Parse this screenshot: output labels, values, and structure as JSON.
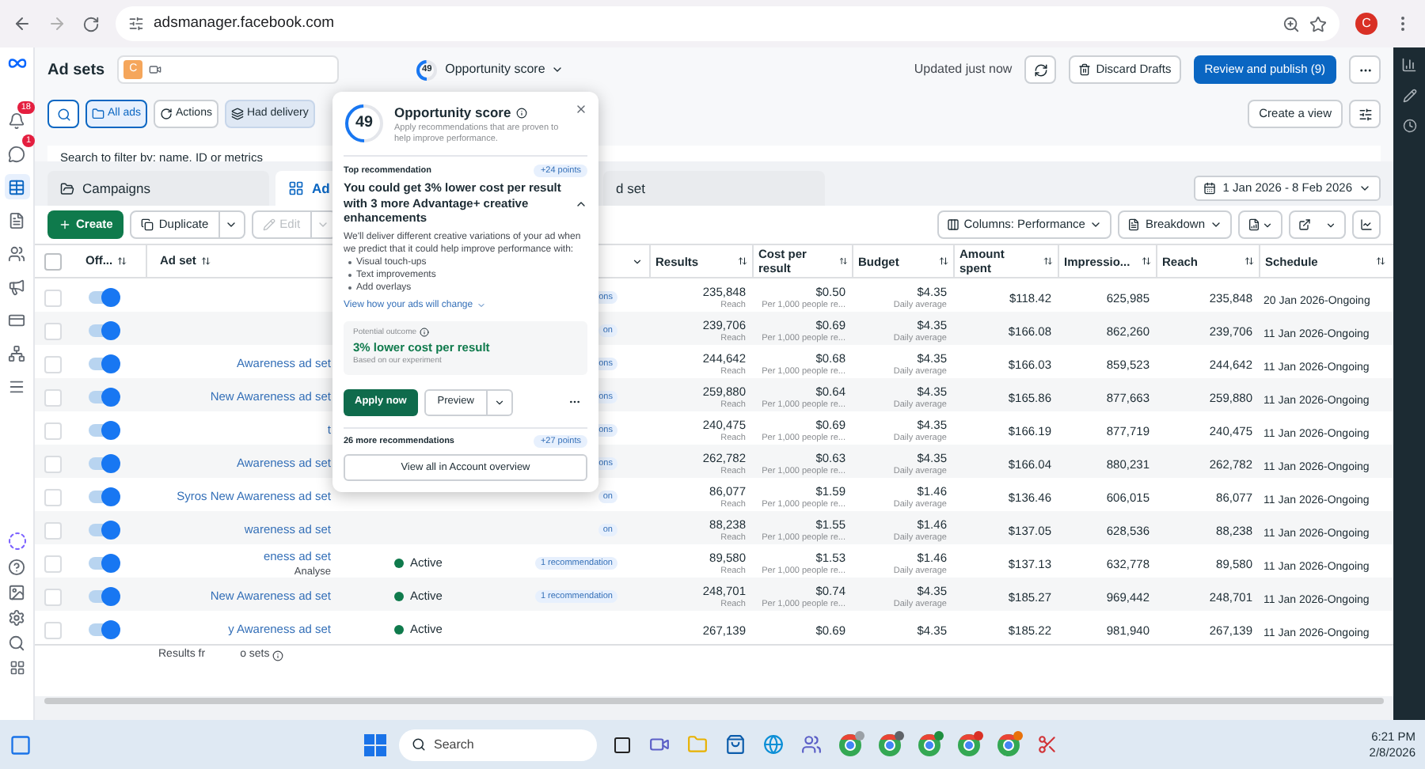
{
  "browser": {
    "url": "adsmanager.facebook.com",
    "avatar": "C"
  },
  "header": {
    "title": "Ad sets",
    "account_badge": "C",
    "score": {
      "value": "49",
      "label": "Opportunity score",
      "level": 0.49
    },
    "updated": "Updated just now",
    "discard": "Discard Drafts",
    "publish": "Review and publish (9)"
  },
  "nav_items": [
    {
      "selected": false,
      "badge": "18"
    },
    {
      "selected": false,
      "badge": "1"
    },
    {
      "selected": true
    },
    {
      "selected": false
    },
    {
      "selected": false
    },
    {
      "selected": false
    },
    {
      "selected": false
    },
    {
      "selected": false
    },
    {
      "selected": false
    }
  ],
  "filters": [
    {
      "kind": "view",
      "label": "All ads"
    },
    {
      "kind": "action",
      "label": "Actions"
    },
    {
      "kind": "filter",
      "label": "Had delivery"
    }
  ],
  "create_view": "Create a view",
  "search": {
    "placeholder": "Search to filter by: name, ID or metrics"
  },
  "tabs": [
    {
      "label": "Campaigns",
      "selected": false
    },
    {
      "label": "Ad",
      "selected": true
    },
    {
      "label": "d set",
      "selected": false
    }
  ],
  "date_range": "1 Jan 2026 - 8 Feb 2026",
  "toolbar": {
    "buttons": [
      {
        "label": "Create",
        "kind": "primary",
        "disabled": false
      },
      {
        "label": "Duplicate",
        "kind": "split",
        "disabled": false
      },
      {
        "label": "Edit",
        "kind": "split",
        "disabled": true
      }
    ],
    "columns": "Columns: Performance",
    "breakdown": "Breakdown"
  },
  "table": {
    "select_all_checked": false,
    "columns": [
      "Off...",
      "Ad set",
      "Results",
      "Cost per result",
      "Budget",
      "Amount spent",
      "Impressio...",
      "Reach",
      "Schedule"
    ],
    "rows": [
      {
        "on": true,
        "checked": false,
        "name": "",
        "recommendations": "ons",
        "results": "235,848",
        "results_note": "Reach",
        "cost": "$0.50",
        "cost_note": "Per 1,000 people re...",
        "budget": "$4.35",
        "budget_note": "Daily average",
        "spent": "$118.42",
        "impressions": "625,985",
        "reach": "235,848",
        "schedule": "20 Jan 2026-Ongoing"
      },
      {
        "on": true,
        "checked": false,
        "name": "",
        "recommendations": "on",
        "results": "239,706",
        "results_note": "Reach",
        "cost": "$0.69",
        "cost_note": "Per 1,000 people re...",
        "budget": "$4.35",
        "budget_note": "Daily average",
        "spent": "$166.08",
        "impressions": "862,260",
        "reach": "239,706",
        "schedule": "11 Jan 2026-Ongoing"
      },
      {
        "on": true,
        "checked": false,
        "name": "Awareness ad set",
        "recommendations": "ons",
        "results": "244,642",
        "results_note": "Reach",
        "cost": "$0.68",
        "cost_note": "Per 1,000 people re...",
        "budget": "$4.35",
        "budget_note": "Daily average",
        "spent": "$166.03",
        "impressions": "859,523",
        "reach": "244,642",
        "schedule": "11 Jan 2026-Ongoing"
      },
      {
        "on": true,
        "checked": false,
        "name": "New Awareness ad set",
        "recommendations": "ons",
        "results": "259,880",
        "results_note": "Reach",
        "cost": "$0.64",
        "cost_note": "Per 1,000 people re...",
        "budget": "$4.35",
        "budget_note": "Daily average",
        "spent": "$165.86",
        "impressions": "877,663",
        "reach": "259,880",
        "schedule": "11 Jan 2026-Ongoing"
      },
      {
        "on": true,
        "checked": false,
        "name": "t",
        "recommendations": "ons",
        "results": "240,475",
        "results_note": "Reach",
        "cost": "$0.69",
        "cost_note": "Per 1,000 people re...",
        "budget": "$4.35",
        "budget_note": "Daily average",
        "spent": "$166.19",
        "impressions": "877,719",
        "reach": "240,475",
        "schedule": "11 Jan 2026-Ongoing"
      },
      {
        "on": true,
        "checked": false,
        "name": "Awareness ad set",
        "recommendations": "ons",
        "results": "262,782",
        "results_note": "Reach",
        "cost": "$0.63",
        "cost_note": "Per 1,000 people re...",
        "budget": "$4.35",
        "budget_note": "Daily average",
        "spent": "$166.04",
        "impressions": "880,231",
        "reach": "262,782",
        "schedule": "11 Jan 2026-Ongoing"
      },
      {
        "on": true,
        "checked": false,
        "name": "Syros New Awareness ad set",
        "recommendations": "on",
        "results": "86,077",
        "results_note": "Reach",
        "cost": "$1.59",
        "cost_note": "Per 1,000 people re...",
        "budget": "$1.46",
        "budget_note": "Daily average",
        "spent": "$136.46",
        "impressions": "606,015",
        "reach": "86,077",
        "schedule": "11 Jan 2026-Ongoing"
      },
      {
        "on": true,
        "checked": false,
        "name": "wareness ad set",
        "recommendations": "on",
        "results": "88,238",
        "results_note": "Reach",
        "cost": "$1.55",
        "cost_note": "Per 1,000 people re...",
        "budget": "$1.46",
        "budget_note": "Daily average",
        "spent": "$137.05",
        "impressions": "628,536",
        "reach": "88,238",
        "schedule": "11 Jan 2026-Ongoing"
      },
      {
        "on": true,
        "checked": false,
        "name": "eness ad set",
        "action": "Analyse",
        "delivery": "Active",
        "recommendations": "1 recommendation",
        "results": "89,580",
        "results_note": "Reach",
        "cost": "$1.53",
        "cost_note": "Per 1,000 people re...",
        "budget": "$1.46",
        "budget_note": "Daily average",
        "spent": "$137.13",
        "impressions": "632,778",
        "reach": "89,580",
        "schedule": "11 Jan 2026-Ongoing"
      },
      {
        "on": true,
        "checked": false,
        "name": "New Awareness ad set",
        "delivery": "Active",
        "recommendations": "1 recommendation",
        "results": "248,701",
        "results_note": "Reach",
        "cost": "$0.74",
        "cost_note": "Per 1,000 people re...",
        "budget": "$4.35",
        "budget_note": "Daily average",
        "spent": "$185.27",
        "impressions": "969,442",
        "reach": "248,701",
        "schedule": "11 Jan 2026-Ongoing"
      },
      {
        "on": true,
        "checked": false,
        "name": "y Awareness ad set",
        "delivery": "Active",
        "results": "267,139",
        "cost": "$0.69",
        "budget": "$4.35",
        "spent": "$185.22",
        "impressions": "981,940",
        "reach": "267,139",
        "schedule": "11 Jan 2026-Ongoing"
      }
    ],
    "footer": [
      "Results fr",
      "o sets"
    ]
  },
  "popup": {
    "score": "49",
    "level": 0.49,
    "title": "Opportunity score",
    "subtitle": "Apply recommendations that are proven to help improve performance.",
    "top_label": "Top recommendation",
    "top_points": "+24 points",
    "heading": "You could get 3% lower cost per result with 3 more Advantage+ creative enhancements",
    "body": "We'll deliver different creative variations of your ad when we predict that it could help improve performance with:",
    "bullets": [
      "Visual touch-ups",
      "Text improvements",
      "Add overlays"
    ],
    "link": "View how your ads will change",
    "outcome_label": "Potential outcome",
    "outcome": "3% lower cost per result",
    "outcome_note": "Based on our experiment",
    "apply": "Apply now",
    "preview": "Preview",
    "more": "26 more recommendations",
    "more_points": "+27 points",
    "view_all": "View all in Account overview"
  },
  "taskbar": {
    "search": "Search",
    "time": "6:21 PM",
    "date": "2/8/2026",
    "chrome_profiles": [
      {
        "color": "#9aa0a6"
      },
      {
        "color": "#5f6368"
      },
      {
        "color": "#1e8e3e"
      },
      {
        "color": "#d93025"
      },
      {
        "color": "#e8710a"
      }
    ]
  }
}
